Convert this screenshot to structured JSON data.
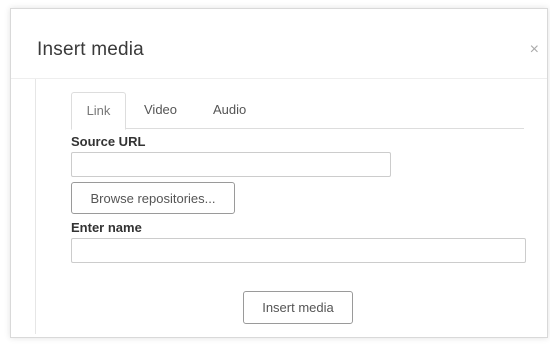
{
  "dialog": {
    "title": "Insert media",
    "close_glyph": "×"
  },
  "tabs": [
    {
      "label": "Link",
      "active": true
    },
    {
      "label": "Video",
      "active": false
    },
    {
      "label": "Audio",
      "active": false
    }
  ],
  "form": {
    "source_url_label": "Source URL",
    "source_url_value": "",
    "browse_button_label": "Browse repositories...",
    "name_label": "Enter name",
    "name_value": "",
    "submit_button_label": "Insert media"
  },
  "colors": {
    "border": "#cccccc",
    "button_border": "#9a9a9a",
    "title_text": "#3a3a3a"
  }
}
